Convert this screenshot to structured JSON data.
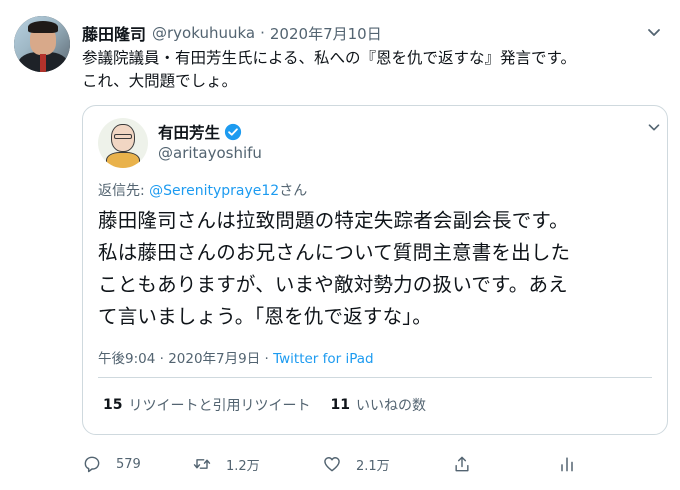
{
  "tweet": {
    "author_name": "藤田隆司",
    "author_handle": "@ryokuhuuka",
    "separator": "·",
    "date": "2020年7月10日",
    "body_line1": "参議院議員・有田芳生氏による、私への『恩を仇で返すな』発言です。",
    "body_line2": "これ、大問題でしょ。"
  },
  "quote": {
    "author_name": "有田芳生",
    "author_handle": "@aritayoshifu",
    "reply_prefix": "返信先: ",
    "reply_mention": "@Serenityprayе12",
    "reply_suffix": "さん",
    "body_line1": "藤田隆司さんは拉致問題の特定失踪者会副会長です。",
    "body_line2": "私は藤田さんのお兄さんについて質問主意書を出した",
    "body_line3": "こともありますが、いまや敵対勢力の扱いです。あえ",
    "body_line4": "て言いましょう。「恩を仇で返すな」。",
    "time": "午後9:04 · 2020年7月9日 · ",
    "via": "Twitter for iPad",
    "retweets_count": "15",
    "retweets_label": "リツイートと引用リツイート",
    "likes_count": "11",
    "likes_label": "いいねの数"
  },
  "actions": {
    "reply_count": "579",
    "retweet_count": "1.2万",
    "like_count": "2.1万"
  },
  "colors": {
    "text": "#0f1419",
    "muted": "#536471",
    "link": "#1d9bf0",
    "border": "#cfd9de"
  }
}
